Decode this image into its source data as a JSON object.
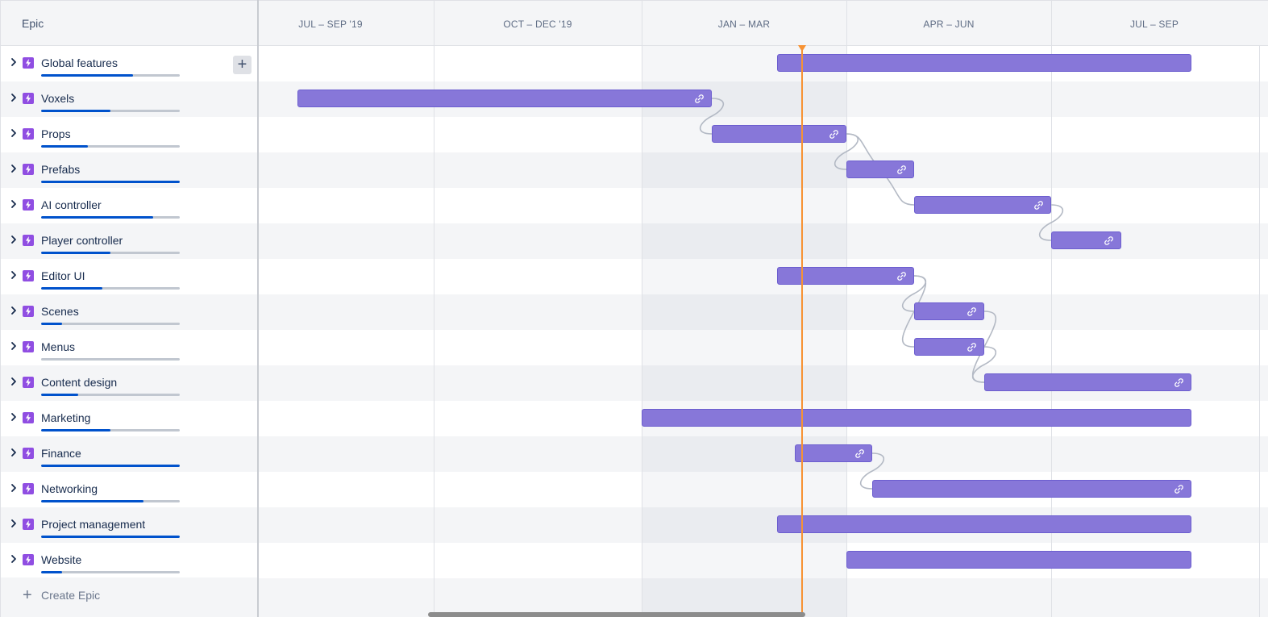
{
  "sidebar": {
    "header": "Epic",
    "epics": [
      {
        "name": "Global features",
        "progress": 0.66,
        "has_add_button": true
      },
      {
        "name": "Voxels",
        "progress": 0.5
      },
      {
        "name": "Props",
        "progress": 0.34
      },
      {
        "name": "Prefabs",
        "progress": 1.0
      },
      {
        "name": "AI controller",
        "progress": 0.81
      },
      {
        "name": "Player controller",
        "progress": 0.5
      },
      {
        "name": "Editor UI",
        "progress": 0.44
      },
      {
        "name": "Scenes",
        "progress": 0.15
      },
      {
        "name": "Menus",
        "progress": 0.0
      },
      {
        "name": "Content design",
        "progress": 0.27
      },
      {
        "name": "Marketing",
        "progress": 0.5
      },
      {
        "name": "Finance",
        "progress": 1.0
      },
      {
        "name": "Networking",
        "progress": 0.74
      },
      {
        "name": "Project management",
        "progress": 1.0
      },
      {
        "name": "Website",
        "progress": 0.15
      }
    ],
    "add_button_label": "+",
    "create_label": "Create Epic",
    "create_icon": "plus-icon"
  },
  "timeline": {
    "quarters": [
      "JUL – SEP '19",
      "OCT – DEC '19",
      "JAN – MAR",
      "APR – JUN",
      "JUL – SEP"
    ],
    "current_quarter": "JAN – MAR",
    "bar_link_icon": "link-icon",
    "colors": {
      "bar": "#8777d9",
      "bar_border": "#6c5ecf",
      "today": "#f79233",
      "progress": "#0052cc",
      "epic_icon": "#904ee2"
    }
  }
}
